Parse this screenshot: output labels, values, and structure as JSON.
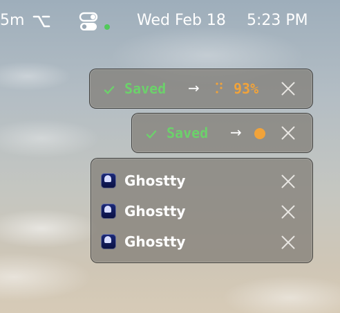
{
  "menubar": {
    "left_fragment": "5m",
    "date": "Wed Feb 18",
    "time": "5:23 PM",
    "status_dot_color": "#52c95a"
  },
  "notifications": [
    {
      "status": "Saved",
      "arrow": "→",
      "progress_text": "93%",
      "progress_color": "#f1a33a"
    },
    {
      "status": "Saved",
      "arrow": "→",
      "indicator_color": "#f1a33a"
    }
  ],
  "apps": [
    {
      "name": "Ghostty",
      "icon": "ghostty-icon"
    },
    {
      "name": "Ghostty",
      "icon": "ghostty-icon"
    },
    {
      "name": "Ghostty",
      "icon": "ghostty-icon"
    }
  ],
  "icons": {
    "check": "check-icon",
    "close": "close-icon",
    "option_key": "option-key-icon",
    "control_center": "control-center-icon"
  }
}
